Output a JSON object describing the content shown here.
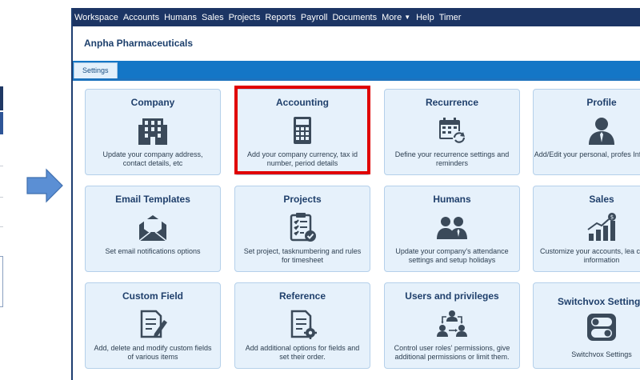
{
  "nav": {
    "items": [
      "Workspace",
      "Accounts",
      "Humans",
      "Sales",
      "Projects",
      "Reports",
      "Payroll",
      "Documents",
      "More",
      "Help",
      "Timer"
    ]
  },
  "header": {
    "company": "Anpha Pharmaceuticals"
  },
  "tabs": {
    "settings": "Settings"
  },
  "cards": [
    {
      "title": "Company",
      "desc": "Update your company address, contact details, etc",
      "icon": "building-icon"
    },
    {
      "title": "Accounting",
      "desc": "Add your company currency, tax id number, period details",
      "icon": "calculator-icon"
    },
    {
      "title": "Recurrence",
      "desc": "Define your recurrence settings and reminders",
      "icon": "calendar-refresh-icon"
    },
    {
      "title": "Profile",
      "desc": "Add/Edit your personal, profes Information",
      "icon": "user-icon"
    },
    {
      "title": "Email Templates",
      "desc": "Set email notifications options",
      "icon": "envelope-icon"
    },
    {
      "title": "Projects",
      "desc": "Set project, tasknumbering and rules for timesheet",
      "icon": "clipboard-check-icon"
    },
    {
      "title": "Humans",
      "desc": "Update your company's attendance settings and setup holidays",
      "icon": "people-icon"
    },
    {
      "title": "Sales",
      "desc": "Customize your accounts, lea contacts information",
      "icon": "sales-chart-icon"
    },
    {
      "title": "Custom Field",
      "desc": "Add, delete and modify custom fields of various items",
      "icon": "edit-document-icon"
    },
    {
      "title": "Reference",
      "desc": "Add additional options for fields and set their order.",
      "icon": "document-gear-icon"
    },
    {
      "title": "Users and privileges",
      "desc": "Control user roles' permissions, give additional permissions or limit them.",
      "icon": "user-network-icon"
    },
    {
      "title": "Switchvox Settings",
      "desc": "Switchvox Settings",
      "icon": "toggle-switch-icon"
    }
  ],
  "colors": {
    "nav_bg": "#1c3564",
    "tab_bar": "#1476c6",
    "card_bg": "#e6f1fb",
    "icon": "#3b4a5a",
    "highlight": "#e00000",
    "arrow": "#5b8fd4"
  }
}
